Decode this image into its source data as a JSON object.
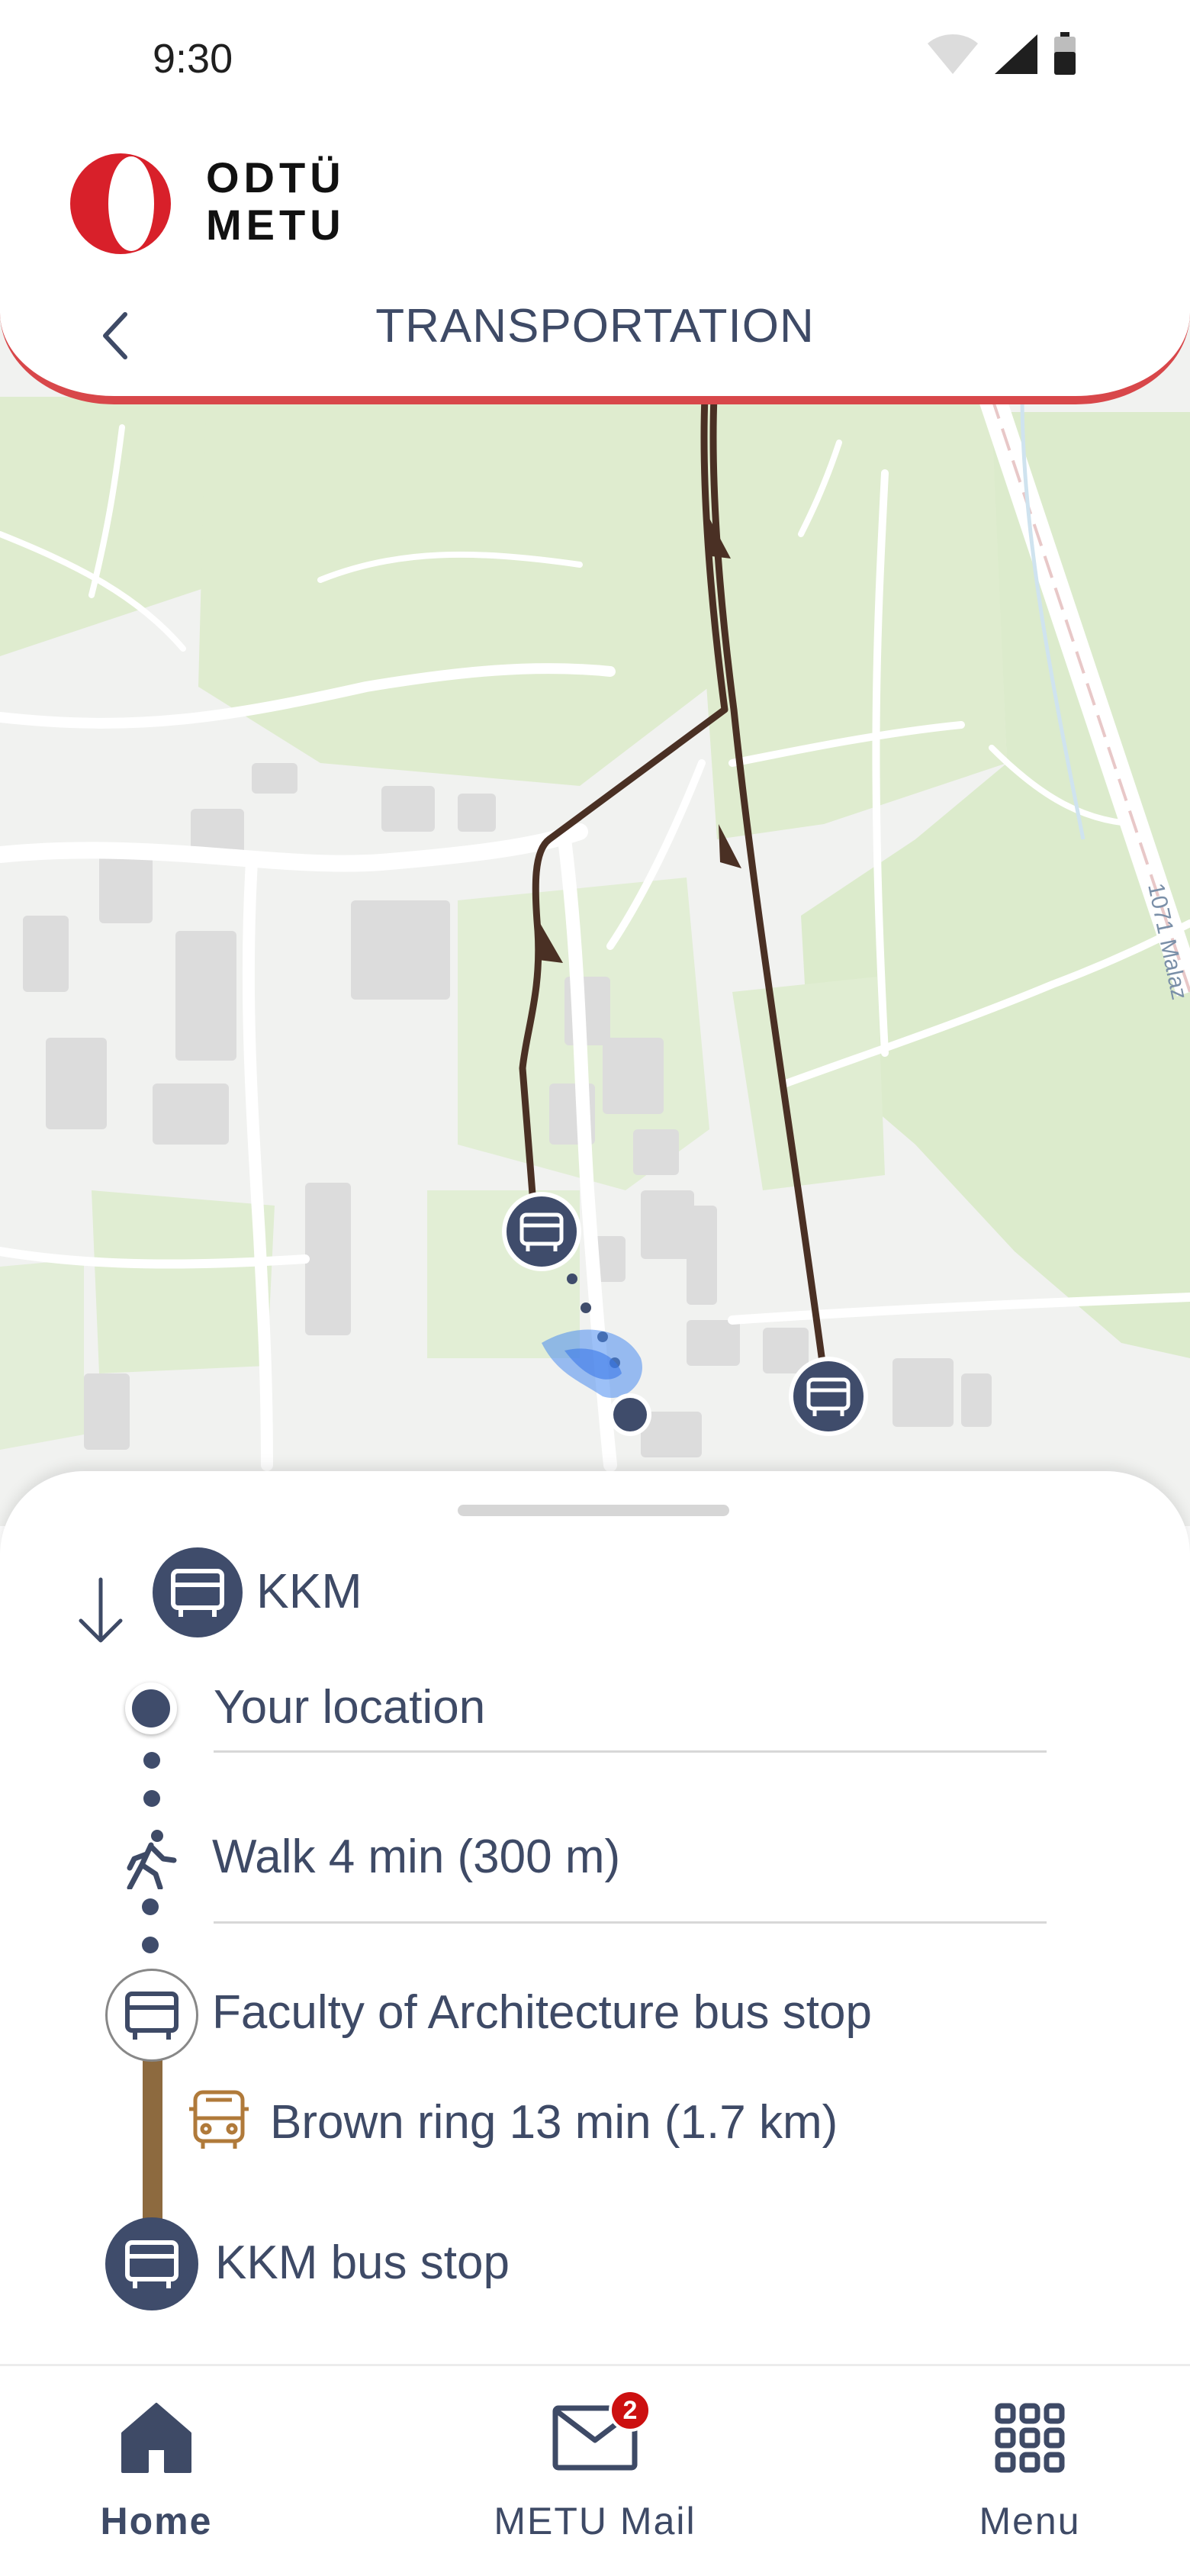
{
  "status_bar": {
    "time": "9:30"
  },
  "brand": {
    "line1": "ODTÜ",
    "line2": "METU"
  },
  "header": {
    "title": "TRANSPORTATION"
  },
  "map": {
    "road_label": "1071 Malaz"
  },
  "route": {
    "destination": "KKM",
    "steps": {
      "start": "Your location",
      "walk": "Walk 4 min (300 m)",
      "board_stop": "Faculty of Architecture bus stop",
      "ride": "Brown ring 13 min (1.7 km)",
      "end_stop": "KKM bus stop"
    },
    "route_color": "#8d6a3f"
  },
  "bottom_nav": {
    "items": [
      {
        "label": "Home",
        "icon": "home-icon",
        "active": true
      },
      {
        "label": "METU Mail",
        "icon": "mail-icon",
        "badge": "2"
      },
      {
        "label": "Menu",
        "icon": "grid-menu-icon"
      }
    ]
  },
  "colors": {
    "accent_red": "#d8474a",
    "navy": "#3f4c6b",
    "brown_route": "#4a3024"
  }
}
